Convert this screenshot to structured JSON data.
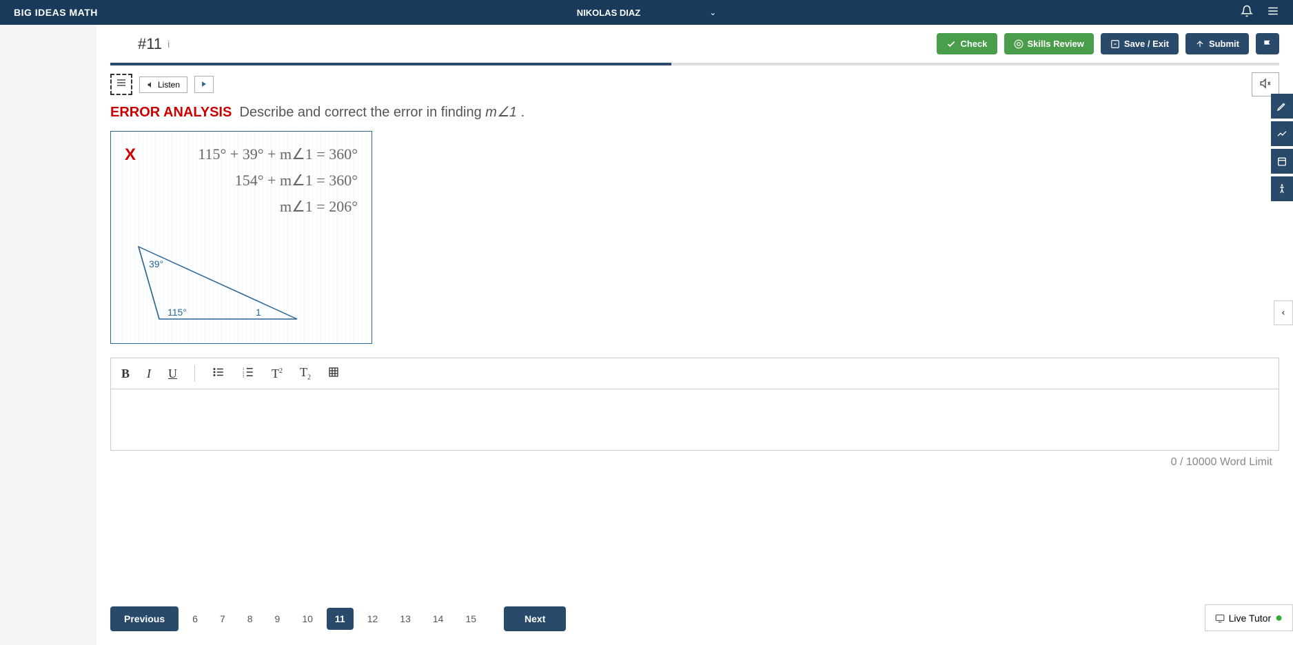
{
  "header": {
    "brand": "BIG IDEAS MATH",
    "user_name": "NIKOLAS DIAZ"
  },
  "subheader": {
    "question_number": "#11",
    "buttons": {
      "check": "Check",
      "skills_review": "Skills Review",
      "save_exit": "Save / Exit",
      "submit": "Submit"
    }
  },
  "listen": {
    "label": "Listen"
  },
  "question": {
    "error_label": "ERROR ANALYSIS",
    "prompt_prefix": "Describe and correct the error in finding ",
    "prompt_var": "m∠1",
    "prompt_suffix": " ."
  },
  "problem": {
    "x_mark": "X",
    "eq1": "115° + 39° + m∠1 = 360°",
    "eq2": "154° + m∠1 = 360°",
    "eq3": "m∠1 = 206°",
    "triangle": {
      "angle_top": "39°",
      "angle_left": "115°",
      "angle_right": "1"
    }
  },
  "editor": {
    "word_limit": "0 / 10000 Word Limit"
  },
  "nav": {
    "previous": "Previous",
    "next": "Next",
    "pages": [
      "6",
      "7",
      "8",
      "9",
      "10",
      "11",
      "12",
      "13",
      "14",
      "15"
    ],
    "active": "11"
  },
  "live_tutor": "Live Tutor"
}
